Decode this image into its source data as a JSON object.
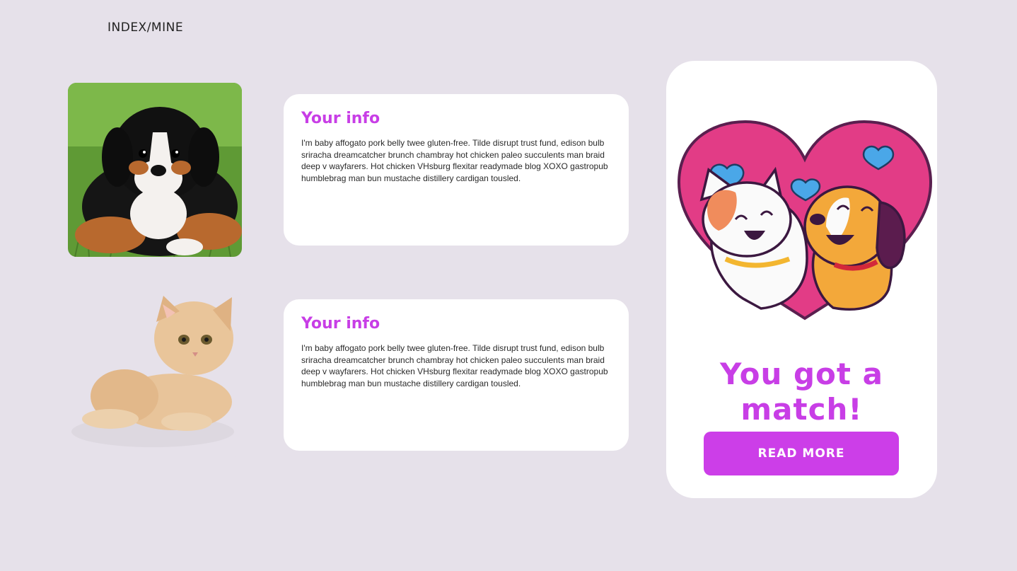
{
  "breadcrumb": "INDEX/MINE",
  "cards": [
    {
      "title": "Your info",
      "body": "I'm baby affogato pork belly twee gluten-free. Tilde disrupt trust fund, edison bulb sriracha dreamcatcher brunch chambray hot chicken paleo succulents man braid deep v wayfarers. Hot chicken VHsburg flexitar readymade blog XOXO gastropub humblebrag man bun mustache distillery cardigan tousled."
    },
    {
      "title": "Your info",
      "body": "I'm baby affogato pork belly twee gluten-free. Tilde disrupt trust fund, edison bulb sriracha dreamcatcher brunch chambray hot chicken paleo succulents man braid deep v wayfarers. Hot chicken VHsburg flexitar readymade blog XOXO gastropub humblebrag man bun mustache distillery cardigan tousled."
    }
  ],
  "match": {
    "headline": "You got a match!",
    "button_label": "READ MORE"
  },
  "colors": {
    "accent": "#c83ee6",
    "background": "#e6e1ea",
    "heart": "#e23c86"
  },
  "icons": [
    "puppy-photo",
    "kitten-photo",
    "cat-dog-heart-illustration"
  ]
}
